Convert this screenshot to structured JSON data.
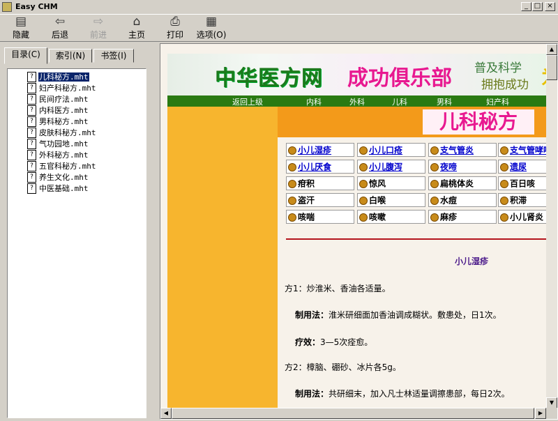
{
  "app": {
    "title": "Easy CHM"
  },
  "toolbar": {
    "buttons": [
      {
        "label": "隐藏",
        "icon": "hide-icon",
        "enabled": true
      },
      {
        "label": "后退",
        "icon": "back-arrow-icon",
        "enabled": true
      },
      {
        "label": "前进",
        "icon": "forward-arrow-icon",
        "enabled": false
      },
      {
        "label": "主页",
        "icon": "home-icon",
        "enabled": true
      },
      {
        "label": "打印",
        "icon": "printer-icon",
        "enabled": true
      },
      {
        "label": "选项(O)",
        "icon": "options-icon",
        "enabled": true
      }
    ]
  },
  "tabs": [
    {
      "label": "目录(C)",
      "active": true
    },
    {
      "label": "索引(N)",
      "active": false
    },
    {
      "label": "书签(I)",
      "active": false
    }
  ],
  "tree": {
    "items": [
      {
        "label": "儿科秘方.mht",
        "selected": true
      },
      {
        "label": "妇产科秘方.mht",
        "selected": false
      },
      {
        "label": "民间疗法.mht",
        "selected": false
      },
      {
        "label": "内科医方.mht",
        "selected": false
      },
      {
        "label": "男科秘方.mht",
        "selected": false
      },
      {
        "label": "皮肤科秘方.mht",
        "selected": false
      },
      {
        "label": "气功园地.mht",
        "selected": false
      },
      {
        "label": "外科秘方.mht",
        "selected": false
      },
      {
        "label": "五官科秘方.mht",
        "selected": false
      },
      {
        "label": "养生文化.mht",
        "selected": false
      },
      {
        "label": "中医基础.mht",
        "selected": false
      }
    ]
  },
  "page": {
    "banner": {
      "logo": "中华医方网",
      "club": "成功俱乐部",
      "slogan1": "普及科学",
      "slogan2": "拥抱成功",
      "extra": "为"
    },
    "nav": [
      "返回上级",
      "内科",
      "外科",
      "儿科",
      "男科",
      "妇产科"
    ],
    "section_title": "儿科秘方",
    "grid": [
      {
        "label": "小儿湿疹",
        "link": true
      },
      {
        "label": "小儿口疮",
        "link": true
      },
      {
        "label": "支气管炎",
        "link": true
      },
      {
        "label": "支气管哮喘",
        "link": true
      },
      {
        "label": "小儿厌食",
        "link": true
      },
      {
        "label": "小儿腹泻",
        "link": true
      },
      {
        "label": "夜啼",
        "link": true
      },
      {
        "label": "遗尿",
        "link": true
      },
      {
        "label": "疳积",
        "link": false
      },
      {
        "label": "惊风",
        "link": false
      },
      {
        "label": "扁桃体炎",
        "link": false
      },
      {
        "label": "百日咳",
        "link": false
      },
      {
        "label": "盗汗",
        "link": false
      },
      {
        "label": "白喉",
        "link": false
      },
      {
        "label": "水痘",
        "link": false
      },
      {
        "label": "积滞",
        "link": false
      },
      {
        "label": "咳喘",
        "link": false
      },
      {
        "label": "咳嗽",
        "link": false
      },
      {
        "label": "麻疹",
        "link": false
      },
      {
        "label": "小儿肾炎",
        "link": false
      }
    ],
    "article": {
      "title": "小儿湿疹",
      "rx1": "方1：炒淮米、香油各适量。",
      "method_label": "制用法：",
      "rx1_method": "淮米研细面加香油调成糊状。敷患处，日1次。",
      "effect_label": "疗效：",
      "rx1_effect": "3—5次痊愈。",
      "rx2": "方2：樟脑、硼砂、冰片各5g。",
      "rx2_method": "共研细末，加入凡士林适量调擦患部，每日2次。"
    }
  }
}
